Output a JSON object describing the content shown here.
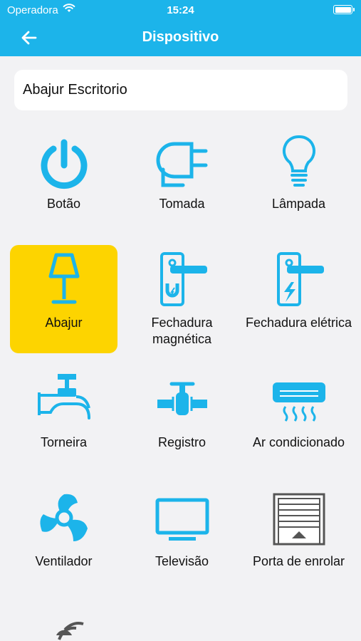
{
  "status_bar": {
    "carrier": "Operadora",
    "time": "15:24"
  },
  "header": {
    "title": "Dispositivo"
  },
  "device_name": "Abajur Escritorio",
  "colors": {
    "accent": "#1cb4ea",
    "selected": "#fdd400",
    "icon_dark": "#555555"
  },
  "devices": [
    {
      "label": "Botão",
      "icon": "power-icon"
    },
    {
      "label": "Tomada",
      "icon": "plug-icon"
    },
    {
      "label": "Lâmpada",
      "icon": "lightbulb-icon"
    },
    {
      "label": "Abajur",
      "icon": "lamp-icon",
      "selected": true
    },
    {
      "label": "Fechadura magnética",
      "icon": "magnetic-lock-icon"
    },
    {
      "label": "Fechadura elétrica",
      "icon": "electric-lock-icon"
    },
    {
      "label": "Torneira",
      "icon": "faucet-icon"
    },
    {
      "label": "Registro",
      "icon": "valve-icon"
    },
    {
      "label": "Ar condicionado",
      "icon": "air-conditioner-icon"
    },
    {
      "label": "Ventilador",
      "icon": "fan-icon"
    },
    {
      "label": "Televisão",
      "icon": "tv-icon"
    },
    {
      "label": "Porta de enrolar",
      "icon": "rolling-door-icon"
    },
    {
      "label": "",
      "icon": "wireless-icon"
    }
  ]
}
